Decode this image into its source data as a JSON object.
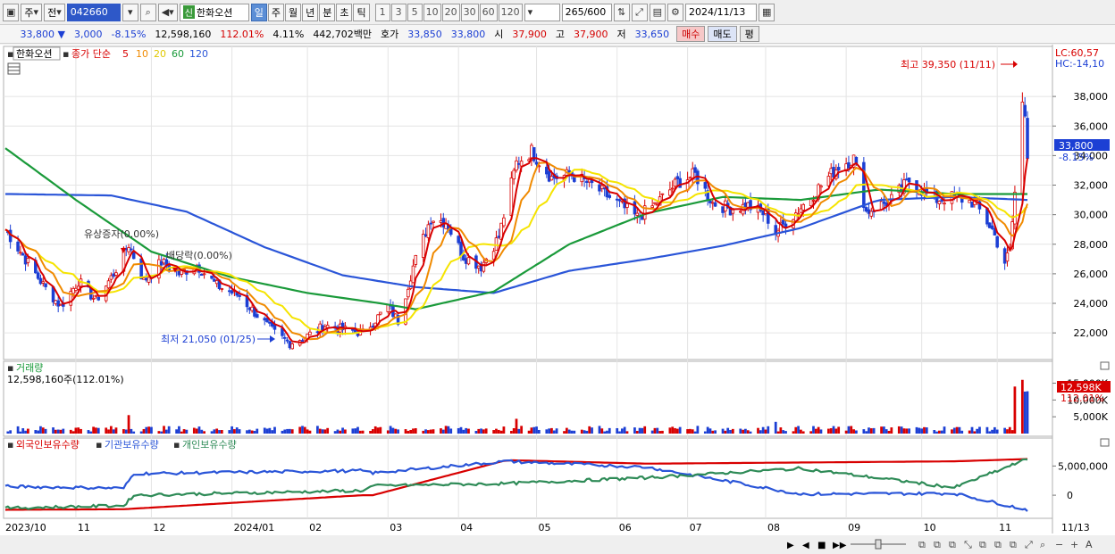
{
  "toolbar": {
    "period_label": "주",
    "prev_label": "전",
    "code": "042660",
    "sin_label": "신",
    "stock_name": "한화오션",
    "tf_tabs": [
      "일",
      "주",
      "월",
      "년",
      "분",
      "초",
      "틱"
    ],
    "active_tab": "일",
    "n_buttons": [
      "1",
      "3",
      "5",
      "10",
      "20",
      "30",
      "60",
      "120"
    ],
    "count": "265",
    "count_total": "/600",
    "date": "2024/11/13"
  },
  "quote": {
    "price": "33,800",
    "down_arrow": "▼",
    "change": "3,000",
    "change_pct": "-8.15%",
    "volume": "12,598,160",
    "volume_ratio": "112.01%",
    "turnover": "4.11%",
    "amount": "442,702백만",
    "ask_label": "호가",
    "ask1": "33,850",
    "ask2": "33,800",
    "open_label": "시",
    "open": "37,900",
    "high_label": "고",
    "high": "37,900",
    "low_label": "저",
    "low": "33,650",
    "buy_label": "매수",
    "sell_label": "매도",
    "avg_label": "평"
  },
  "price_panel": {
    "stock_label": "한화오션",
    "ma_label": "종가 단순",
    "ma_periods": [
      "5",
      "10",
      "20",
      "60",
      "120"
    ],
    "lc_label": "LC:60,57",
    "hc_label": "HC:-14,10",
    "high_annot": "최고 39,350 (11/11)",
    "low_annot": "최저 21,050 (01/25)",
    "event1": "유상증자(0.00%)",
    "event2": "배당락(0.00%)",
    "price_tag": "33,800",
    "price_tag_pct": "-8.15%"
  },
  "volume_panel": {
    "title": "거래량",
    "value": "12,598,160주(112.01%)",
    "tag": "12,598K",
    "tag_pct": "112.01%"
  },
  "holding_panel": {
    "titles": [
      "외국인보유수량",
      "기관보유수량",
      "개인보유수량"
    ]
  },
  "x_labels": [
    "2023/10",
    "11",
    "12",
    "2024/01",
    "02",
    "03",
    "04",
    "05",
    "06",
    "07",
    "08",
    "09",
    "10",
    "11",
    "11/13"
  ],
  "colors": {
    "up": "#d80000",
    "down": "#1c3fd4",
    "ma5": "#d80000",
    "ma10": "#f08a00",
    "ma20": "#f5e400",
    "ma60": "#1a9a3a",
    "ma120": "#2a55d8",
    "foreign": "#d80000",
    "institution": "#2a55d8",
    "individual": "#2e8b57"
  },
  "chart_data": [
    {
      "type": "candlestick",
      "title": "한화오션",
      "y_ticks": [
        22000,
        24000,
        26000,
        28000,
        30000,
        32000,
        34000,
        36000,
        38000
      ],
      "ylim": [
        20500,
        40000
      ],
      "close_series": [
        {
          "date": "2023/10/04",
          "value": 29000
        },
        {
          "date": "2023/10/12",
          "value": 27000
        },
        {
          "date": "2023/10/20",
          "value": 25000
        },
        {
          "date": "2023/10/26",
          "value": 23800
        },
        {
          "date": "2023/11/02",
          "value": 25500
        },
        {
          "date": "2023/11/09",
          "value": 24200
        },
        {
          "date": "2023/11/16",
          "value": 26000
        },
        {
          "date": "2023/11/22",
          "value": 28000
        },
        {
          "date": "2023/11/28",
          "value": 25500
        },
        {
          "date": "2023/12/05",
          "value": 26800
        },
        {
          "date": "2023/12/12",
          "value": 26000
        },
        {
          "date": "2023/12/19",
          "value": 26600
        },
        {
          "date": "2023/12/27",
          "value": 25200
        },
        {
          "date": "2024/01/05",
          "value": 24500
        },
        {
          "date": "2024/01/12",
          "value": 23200
        },
        {
          "date": "2024/01/19",
          "value": 22000
        },
        {
          "date": "2024/01/25",
          "value": 21300
        },
        {
          "date": "2024/02/01",
          "value": 21800
        },
        {
          "date": "2024/02/08",
          "value": 22500
        },
        {
          "date": "2024/02/16",
          "value": 22200
        },
        {
          "date": "2024/02/23",
          "value": 22000
        },
        {
          "date": "2024/03/04",
          "value": 23800
        },
        {
          "date": "2024/03/08",
          "value": 22800
        },
        {
          "date": "2024/03/14",
          "value": 26500
        },
        {
          "date": "2024/03/21",
          "value": 29800
        },
        {
          "date": "2024/03/27",
          "value": 29500
        },
        {
          "date": "2024/04/03",
          "value": 27200
        },
        {
          "date": "2024/04/10",
          "value": 26500
        },
        {
          "date": "2024/04/17",
          "value": 28500
        },
        {
          "date": "2024/04/24",
          "value": 33500
        },
        {
          "date": "2024/04/30",
          "value": 34300
        },
        {
          "date": "2024/05/08",
          "value": 32500
        },
        {
          "date": "2024/05/16",
          "value": 32700
        },
        {
          "date": "2024/05/24",
          "value": 32000
        },
        {
          "date": "2024/06/03",
          "value": 30800
        },
        {
          "date": "2024/06/11",
          "value": 29800
        },
        {
          "date": "2024/06/19",
          "value": 30800
        },
        {
          "date": "2024/06/27",
          "value": 32200
        },
        {
          "date": "2024/07/04",
          "value": 32700
        },
        {
          "date": "2024/07/11",
          "value": 30800
        },
        {
          "date": "2024/07/18",
          "value": 30400
        },
        {
          "date": "2024/07/25",
          "value": 30600
        },
        {
          "date": "2024/08/01",
          "value": 30000
        },
        {
          "date": "2024/08/05",
          "value": 28800
        },
        {
          "date": "2024/08/14",
          "value": 30300
        },
        {
          "date": "2024/08/22",
          "value": 31800
        },
        {
          "date": "2024/08/30",
          "value": 33300
        },
        {
          "date": "2024/09/05",
          "value": 33800
        },
        {
          "date": "2024/09/10",
          "value": 30200
        },
        {
          "date": "2024/09/20",
          "value": 31000
        },
        {
          "date": "2024/09/27",
          "value": 32300
        },
        {
          "date": "2024/10/07",
          "value": 31000
        },
        {
          "date": "2024/10/15",
          "value": 31200
        },
        {
          "date": "2024/10/23",
          "value": 30800
        },
        {
          "date": "2024/10/30",
          "value": 29000
        },
        {
          "date": "2024/11/04",
          "value": 26800
        },
        {
          "date": "2024/11/06",
          "value": 27500
        },
        {
          "date": "2024/11/08",
          "value": 31500
        },
        {
          "date": "2024/11/11",
          "value": 37500
        },
        {
          "date": "2024/11/12",
          "value": 36800
        },
        {
          "date": "2024/11/13",
          "value": 33800
        }
      ],
      "ma120": [
        {
          "date": "2023/10/04",
          "value": 31400
        },
        {
          "date": "2023/11/15",
          "value": 31300
        },
        {
          "date": "2023/12/15",
          "value": 30200
        },
        {
          "date": "2024/01/15",
          "value": 27800
        },
        {
          "date": "2024/02/15",
          "value": 25900
        },
        {
          "date": "2024/03/15",
          "value": 25100
        },
        {
          "date": "2024/04/15",
          "value": 24700
        },
        {
          "date": "2024/05/15",
          "value": 26200
        },
        {
          "date": "2024/06/15",
          "value": 27000
        },
        {
          "date": "2024/07/15",
          "value": 27900
        },
        {
          "date": "2024/08/15",
          "value": 29100
        },
        {
          "date": "2024/09/15",
          "value": 31000
        },
        {
          "date": "2024/10/15",
          "value": 31200
        },
        {
          "date": "2024/11/13",
          "value": 31000
        }
      ],
      "ma60": [
        {
          "date": "2023/10/04",
          "value": 34500
        },
        {
          "date": "2023/11/01",
          "value": 31000
        },
        {
          "date": "2023/12/01",
          "value": 27500
        },
        {
          "date": "2024/01/01",
          "value": 25800
        },
        {
          "date": "2024/02/01",
          "value": 24700
        },
        {
          "date": "2024/03/01",
          "value": 24000
        },
        {
          "date": "2024/03/15",
          "value": 23600
        },
        {
          "date": "2024/04/15",
          "value": 24800
        },
        {
          "date": "2024/05/15",
          "value": 28000
        },
        {
          "date": "2024/06/15",
          "value": 30100
        },
        {
          "date": "2024/07/15",
          "value": 31200
        },
        {
          "date": "2024/08/15",
          "value": 31000
        },
        {
          "date": "2024/09/15",
          "value": 31700
        },
        {
          "date": "2024/10/15",
          "value": 31400
        },
        {
          "date": "2024/11/13",
          "value": 31400
        }
      ]
    },
    {
      "type": "bar",
      "title": "거래량",
      "y_ticks": [
        "5,000K",
        "10,000K",
        "15,000K"
      ],
      "ylim": [
        0,
        17000000
      ],
      "values_desc": "daily volume, mostly 0.5M–2.5M, spikes ~5.5M (Nov 2023, Apr 2024, Aug 2024), 14–16M in Nov 2024",
      "spikes": [
        {
          "date": "2023/11/22",
          "value": 5500000
        },
        {
          "date": "2024/04/24",
          "value": 4400000
        },
        {
          "date": "2024/08/05",
          "value": 3500000
        },
        {
          "date": "2024/11/08",
          "value": 14000000
        },
        {
          "date": "2024/11/11",
          "value": 16000000
        },
        {
          "date": "2024/11/12",
          "value": 12500000
        },
        {
          "date": "2024/11/13",
          "value": 12598160
        }
      ]
    },
    {
      "type": "line",
      "title": "외국인보유수량 / 기관보유수량 / 개인보유수량",
      "y_ticks": [
        "0",
        "5,000,000"
      ],
      "series": [
        {
          "name": "외국인보유수량",
          "values": [
            -2500000,
            -2400000,
            -2300000,
            0,
            0,
            6000000,
            5400000,
            5600000,
            5800000,
            6200000
          ]
        },
        {
          "name": "기관보유수량",
          "values": [
            1500000,
            1200000,
            3700000,
            4200000,
            3800000,
            5800000,
            4800000,
            200000,
            300000,
            -2500000
          ]
        },
        {
          "name": "개인보유수량",
          "values": [
            -2200000,
            -1800000,
            0,
            800000,
            1600000,
            2000000,
            3000000,
            4600000,
            1300000,
            6200000
          ]
        }
      ]
    }
  ]
}
